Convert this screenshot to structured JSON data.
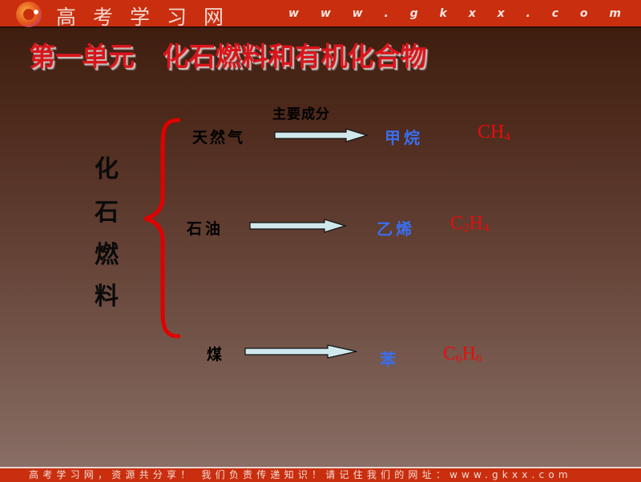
{
  "header": {
    "logo": "gkxx-logo-icon",
    "site_name": "高考学习网",
    "site_url": "w w w . g k x x . c o m"
  },
  "slide": {
    "title": "第一单元   化石燃料和有机化合物",
    "category_chars": [
      "化",
      "石",
      "燃",
      "料"
    ],
    "column_label": "主要成分",
    "rows": [
      {
        "source": "天然气",
        "product": "甲烷",
        "formula_parts": [
          "CH",
          "4"
        ]
      },
      {
        "source": "石油",
        "product": "乙烯",
        "formula_parts": [
          "C",
          "2",
          "H",
          "4"
        ]
      },
      {
        "source": "煤",
        "product": "苯",
        "formula_parts": [
          "C",
          "6",
          "H",
          "6"
        ]
      }
    ],
    "colors": {
      "title": "#d9151b",
      "brace": "#e00000",
      "product": "#3a6ef0",
      "formula": "#ea0c0c",
      "arrow_fill": "#cfe8ec"
    }
  },
  "footer": {
    "text": "高考学习网，资源共分享！ 我们负责传递知识！请记住我们的网址：www.gkxx.com"
  }
}
